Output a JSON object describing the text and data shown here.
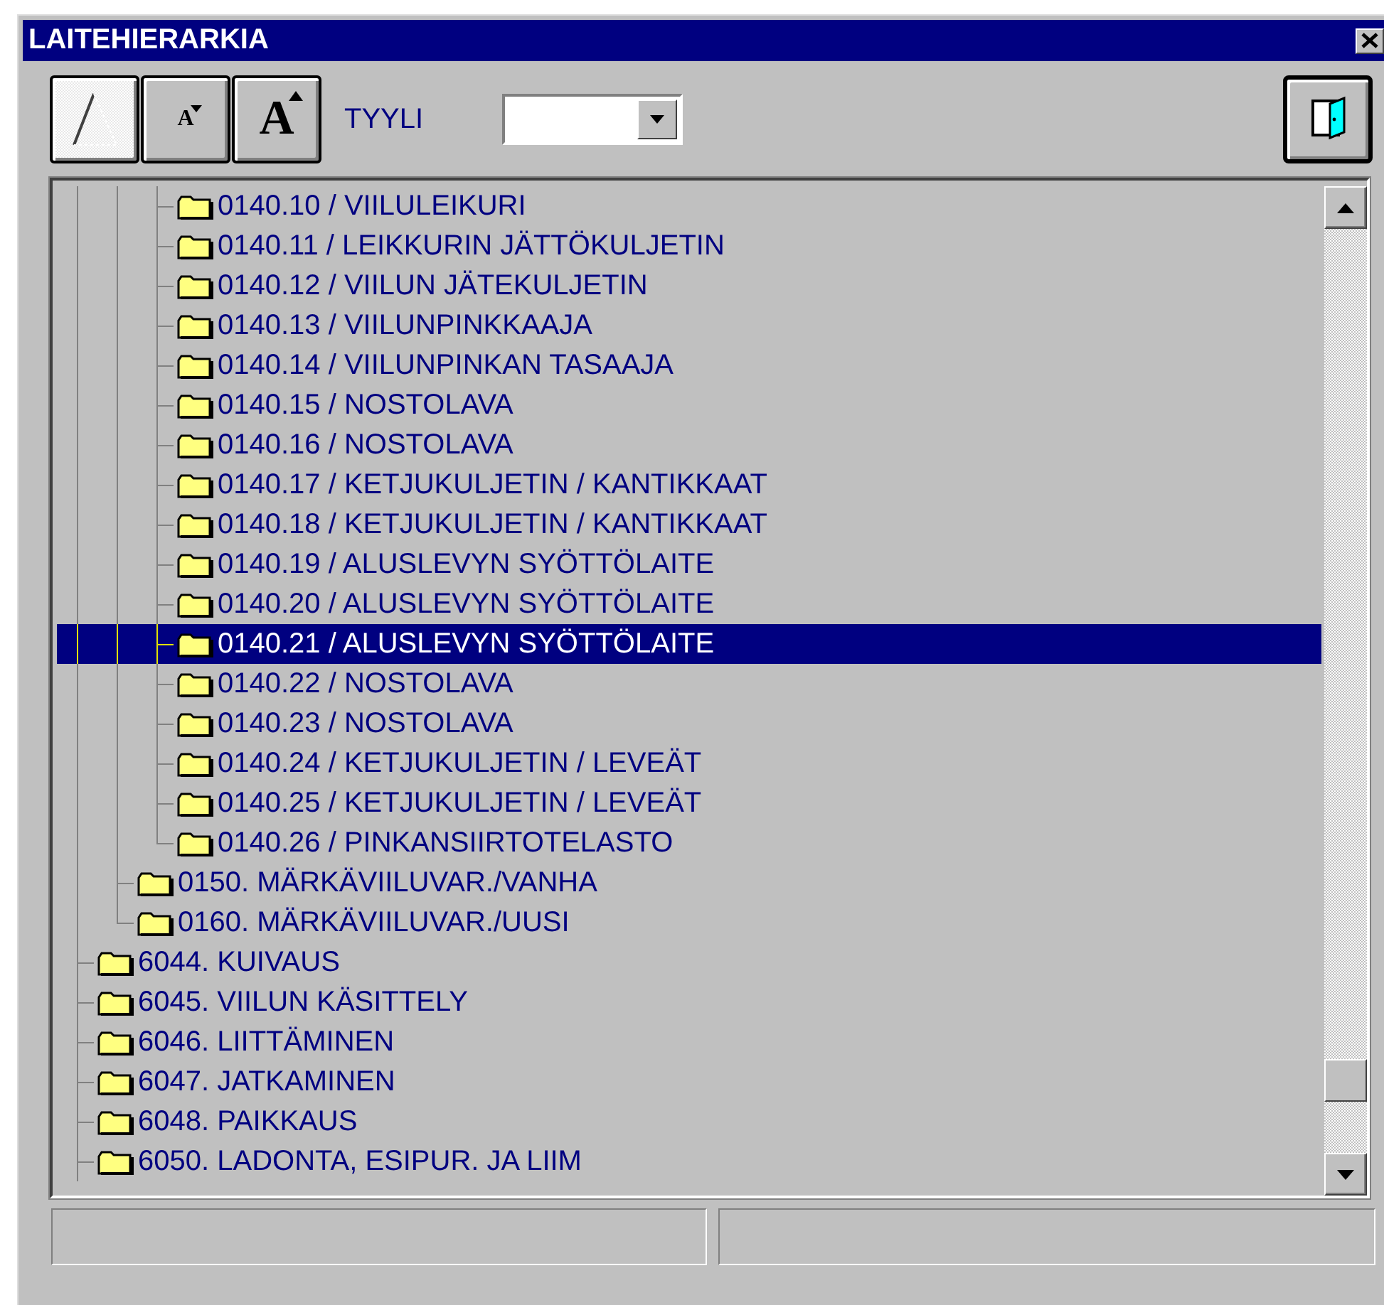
{
  "window": {
    "title": "LAITEHIERARKIA"
  },
  "toolbar": {
    "buttons": [
      {
        "kind": "shape",
        "pressed": true
      },
      {
        "kind": "smaller",
        "glyph": "A",
        "pressed": false
      },
      {
        "kind": "larger",
        "glyph": "A",
        "pressed": false
      }
    ],
    "style_label": "TYYLI"
  },
  "tree": {
    "continues_below": true,
    "items": [
      {
        "children": [
          {
            "children": [
              {
                "label": "0140.10 / VIILULEIKURI",
                "selected": false
              },
              {
                "label": "0140.11 / LEIKKURIN JÄTTÖKULJETIN",
                "selected": false
              },
              {
                "label": "0140.12 / VIILUN JÄTEKULJETIN",
                "selected": false
              },
              {
                "label": "0140.13 / VIILUNPINKKAAJA",
                "selected": false
              },
              {
                "label": "0140.14 / VIILUNPINKAN TASAAJA",
                "selected": false
              },
              {
                "label": "0140.15 / NOSTOLAVA",
                "selected": false
              },
              {
                "label": "0140.16 / NOSTOLAVA",
                "selected": false
              },
              {
                "label": "0140.17 / KETJUKULJETIN / KANTIKKAAT",
                "selected": false
              },
              {
                "label": "0140.18 / KETJUKULJETIN / KANTIKKAAT",
                "selected": false
              },
              {
                "label": "0140.19 / ALUSLEVYN SYÖTTÖLAITE",
                "selected": false
              },
              {
                "label": "0140.20 / ALUSLEVYN SYÖTTÖLAITE",
                "selected": false
              },
              {
                "label": "0140.21 / ALUSLEVYN SYÖTTÖLAITE",
                "selected": true
              },
              {
                "label": "0140.22 / NOSTOLAVA",
                "selected": false
              },
              {
                "label": "0140.23 / NOSTOLAVA",
                "selected": false
              },
              {
                "label": "0140.24 / KETJUKULJETIN / LEVEÄT",
                "selected": false
              },
              {
                "label": "0140.25 / KETJUKULJETIN / LEVEÄT",
                "selected": false
              },
              {
                "label": "0140.26 / PINKANSIIRTOTELASTO",
                "selected": false
              }
            ]
          },
          {
            "label": "0150. MÄRKÄVIILUVAR./VANHA",
            "selected": false
          },
          {
            "label": "0160. MÄRKÄVIILUVAR./UUSI",
            "selected": false
          }
        ]
      },
      {
        "label": "6044. KUIVAUS",
        "selected": false
      },
      {
        "label": "6045. VIILUN KÄSITTELY",
        "selected": false
      },
      {
        "label": "6046. LIITTÄMINEN",
        "selected": false
      },
      {
        "label": "6047. JATKAMINEN",
        "selected": false
      },
      {
        "label": "6048. PAIKKAUS",
        "selected": false
      },
      {
        "label": "6050. LADONTA, ESIPUR. JA LIIM",
        "selected": false
      }
    ]
  }
}
